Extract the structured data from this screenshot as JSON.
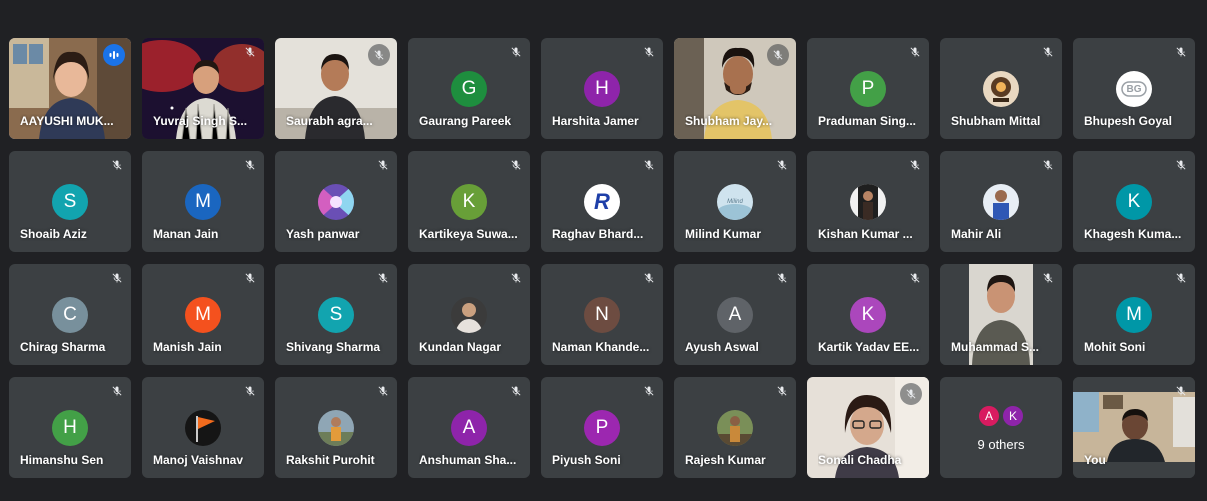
{
  "participants": [
    {
      "name": "AAYUSHI MUK...",
      "type": "video",
      "video": "woman-room",
      "speaking": true
    },
    {
      "name": "Yuvraj Singh S...",
      "type": "video",
      "video": "space-man",
      "mute": "plain"
    },
    {
      "name": "Saurabh agra...",
      "type": "video",
      "video": "man-white-wall",
      "mute": "bubble"
    },
    {
      "name": "Gaurang Pareek",
      "type": "letter",
      "letter": "G",
      "color": "#1e8e3e"
    },
    {
      "name": "Harshita Jamer",
      "type": "letter",
      "letter": "H",
      "color": "#8e24aa"
    },
    {
      "name": "Shubham Jay...",
      "type": "video",
      "video": "man-yellow-shirt",
      "mute": "bubble"
    },
    {
      "name": "Praduman Sing...",
      "type": "letter",
      "letter": "P",
      "color": "#43a047"
    },
    {
      "name": "Shubham Mittal",
      "type": "photo",
      "photo": "lamp-avatar"
    },
    {
      "name": "Bhupesh Goyal",
      "type": "photo",
      "photo": "bg-logo-avatar",
      "text": "BG"
    },
    {
      "name": "Shoaib Aziz",
      "type": "letter",
      "letter": "S",
      "color": "#12a4af"
    },
    {
      "name": "Manan Jain",
      "type": "letter",
      "letter": "M",
      "color": "#1a66c0"
    },
    {
      "name": "Yash panwar",
      "type": "photo",
      "photo": "abstract-avatar"
    },
    {
      "name": "Kartikeya Suwa...",
      "type": "letter",
      "letter": "K",
      "color": "#689f38"
    },
    {
      "name": "Raghav Bhard...",
      "type": "photo",
      "photo": "r-logo-avatar",
      "text": "R"
    },
    {
      "name": "Milind Kumar",
      "type": "photo",
      "photo": "milind-avatar",
      "text": "Milind"
    },
    {
      "name": "Kishan Kumar ...",
      "type": "photo",
      "photo": "person-dark-avatar"
    },
    {
      "name": "Mahir Ali",
      "type": "photo",
      "photo": "person-blue-avatar"
    },
    {
      "name": "Khagesh Kuma...",
      "type": "letter",
      "letter": "K",
      "color": "#0097a7"
    },
    {
      "name": "Chirag Sharma",
      "type": "letter",
      "letter": "C",
      "color": "#78909c"
    },
    {
      "name": "Manish Jain",
      "type": "letter",
      "letter": "M",
      "color": "#f4511e"
    },
    {
      "name": "Shivang Sharma",
      "type": "letter",
      "letter": "S",
      "color": "#12a4af"
    },
    {
      "name": "Kundan Nagar",
      "type": "photo",
      "photo": "person-light-avatar"
    },
    {
      "name": "Naman Khande...",
      "type": "letter",
      "letter": "N",
      "color": "#6d4c41"
    },
    {
      "name": "Ayush Aswal",
      "type": "letter",
      "letter": "A",
      "color": "#5f6368"
    },
    {
      "name": "Kartik Yadav EE...",
      "type": "letter",
      "letter": "K",
      "color": "#ab47bc"
    },
    {
      "name": "Muhammad S...",
      "type": "video",
      "video": "young-man-portrait",
      "mute": "plain",
      "portrait": true
    },
    {
      "name": "Mohit Soni",
      "type": "letter",
      "letter": "M",
      "color": "#0097a7"
    },
    {
      "name": "Himanshu Sen",
      "type": "letter",
      "letter": "H",
      "color": "#43a047"
    },
    {
      "name": "Manoj Vaishnav",
      "type": "photo",
      "photo": "flag-avatar"
    },
    {
      "name": "Rakshit Purohit",
      "type": "photo",
      "photo": "person-outdoor-avatar"
    },
    {
      "name": "Anshuman Sha...",
      "type": "letter",
      "letter": "A",
      "color": "#8e24aa"
    },
    {
      "name": "Piyush Soni",
      "type": "letter",
      "letter": "P",
      "color": "#9c27b0"
    },
    {
      "name": "Rajesh Kumar",
      "type": "photo",
      "photo": "person-garden-avatar"
    },
    {
      "name": "Sonali Chadha",
      "type": "video",
      "video": "woman-glasses",
      "mute": "bubble"
    },
    {
      "name": "",
      "type": "others",
      "label": "9 others",
      "minis": [
        {
          "letter": "A",
          "color": "#d81b60"
        },
        {
          "letter": "K",
          "color": "#8e24aa"
        }
      ]
    },
    {
      "name": "You",
      "type": "video",
      "video": "self-room",
      "mute": "plain"
    }
  ]
}
